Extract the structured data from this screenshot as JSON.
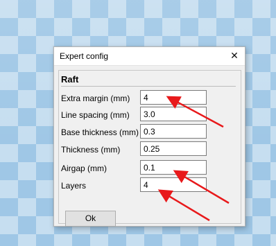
{
  "dialog": {
    "title": "Expert config",
    "close_glyph": "✕",
    "section_title": "Raft",
    "fields": [
      {
        "label": "Extra margin (mm)",
        "value": "4"
      },
      {
        "label": "Line spacing (mm)",
        "value": "3.0"
      },
      {
        "label": "Base thickness (mm)",
        "value": "0.3"
      },
      {
        "label": "Thickness (mm)",
        "value": "0.25"
      },
      {
        "label": "Airgap (mm)",
        "value": "0.1"
      },
      {
        "label": "Layers",
        "value": "4"
      }
    ],
    "ok_label": "Ok"
  },
  "annotations": {
    "arrow_color": "#e8191b"
  }
}
